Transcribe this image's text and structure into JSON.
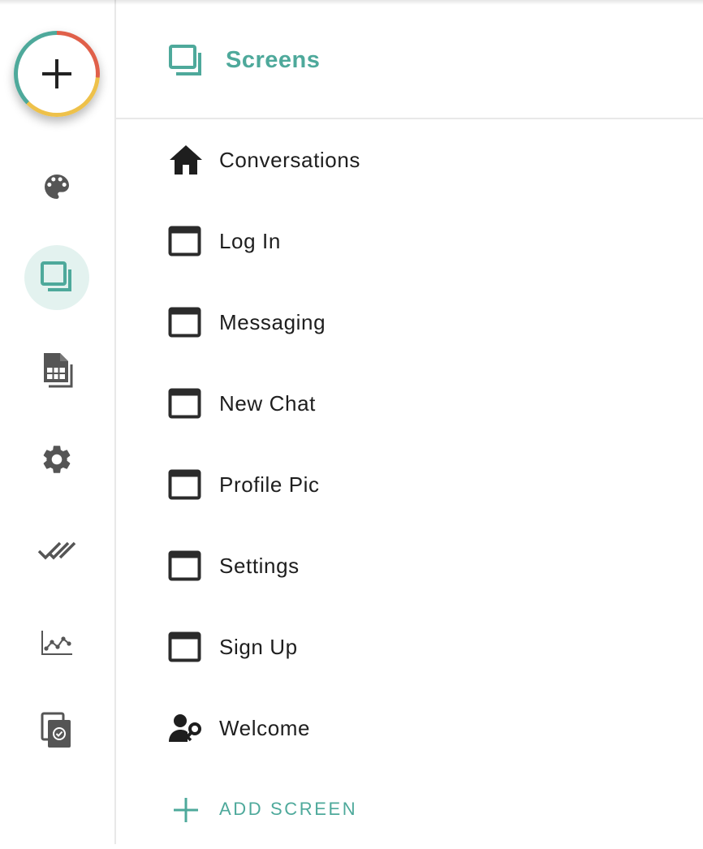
{
  "rail": {
    "fab": {
      "icon": "plus-icon"
    },
    "items": [
      {
        "icon": "palette-icon",
        "active": false
      },
      {
        "icon": "screens-icon",
        "active": true
      },
      {
        "icon": "data-sheet-icon",
        "active": false
      },
      {
        "icon": "gear-icon",
        "active": false
      },
      {
        "icon": "double-check-icon",
        "active": false
      },
      {
        "icon": "analytics-icon",
        "active": false
      },
      {
        "icon": "publish-icon",
        "active": false
      }
    ]
  },
  "panel": {
    "title": "Screens",
    "title_icon": "screens-icon",
    "screens": [
      {
        "label": "Conversations",
        "icon": "home-icon"
      },
      {
        "label": "Log In",
        "icon": "window-icon"
      },
      {
        "label": "Messaging",
        "icon": "window-icon"
      },
      {
        "label": "New Chat",
        "icon": "window-icon"
      },
      {
        "label": "Profile Pic",
        "icon": "window-icon"
      },
      {
        "label": "Settings",
        "icon": "window-icon"
      },
      {
        "label": "Sign Up",
        "icon": "window-icon"
      },
      {
        "label": "Welcome",
        "icon": "user-key-icon"
      }
    ],
    "add_label": "ADD SCREEN",
    "add_icon": "plus-icon"
  },
  "colors": {
    "accent": "#4ea99b",
    "active_bg": "#e3f2ef",
    "icon_gray": "#555555",
    "text": "#1e1e1e",
    "ring_red": "#e0604a",
    "ring_yellow": "#eec14a",
    "ring_teal": "#4ea99b"
  }
}
